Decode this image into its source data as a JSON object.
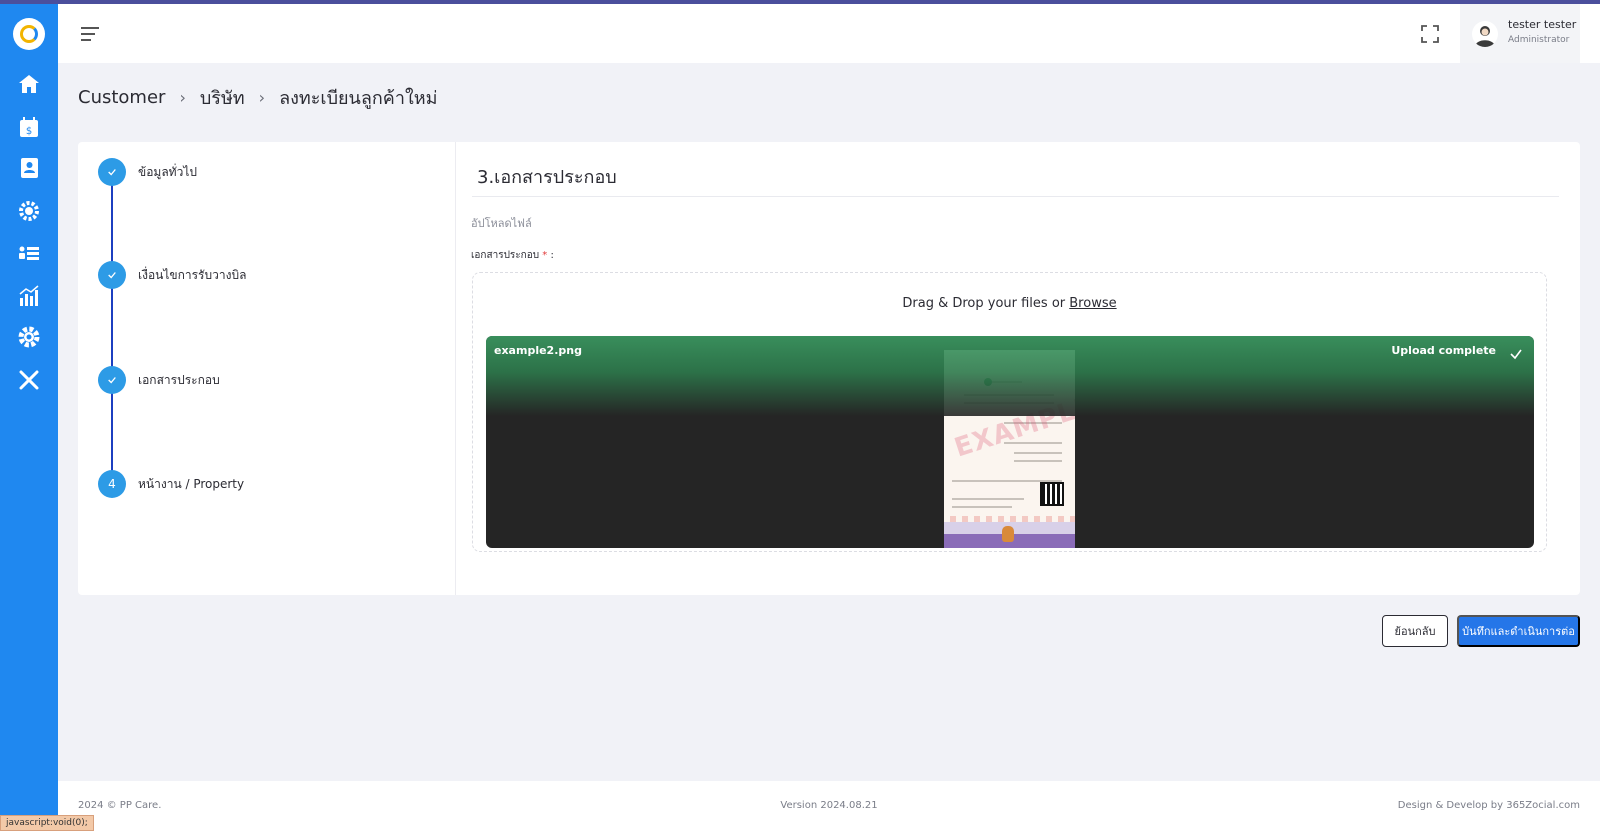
{
  "header": {
    "user_name": "tester tester",
    "user_role": "Administrator"
  },
  "sidebar": {
    "items": [
      {
        "icon": "home-icon"
      },
      {
        "icon": "billing-calendar-icon"
      },
      {
        "icon": "contact-book-icon"
      },
      {
        "icon": "users-gear-icon"
      },
      {
        "icon": "list-icon"
      },
      {
        "icon": "chart-icon"
      },
      {
        "icon": "gear-icon"
      },
      {
        "icon": "tools-icon"
      }
    ]
  },
  "breadcrumb": [
    "Customer",
    "บริษัท",
    "ลงทะเบียนลูกค้าใหม่"
  ],
  "steps": [
    {
      "marker": "",
      "label": "ข้อมูลทั่วไป",
      "done": true
    },
    {
      "marker": "",
      "label": "เงื่อนไขการรับวางบิล",
      "done": true
    },
    {
      "marker": "",
      "label": "เอกสารประกอบ",
      "done": true
    },
    {
      "marker": "4",
      "label": "หน้างาน / Property",
      "done": false
    }
  ],
  "section": {
    "title": "3.เอกสารประกอบ",
    "subhead": "อัปโหลดไฟล์",
    "field_label": "เอกสารประกอบ",
    "required_mark": "*",
    "field_suffix": ":"
  },
  "upload": {
    "drop_text": "Drag & Drop your files or",
    "browse_text": "Browse",
    "file_name": "example2.png",
    "status": "Upload complete"
  },
  "actions": {
    "back_label": "ย้อนกลับ",
    "save_label": "บันทึกและดำเนินการต่อ"
  },
  "footer": {
    "left": "2024 © PP Care.",
    "center": "Version 2024.08.21",
    "right": "Design & Develop by 365Zocial.com"
  },
  "status_bar": "javascript:void(0);",
  "colors": {
    "sidebar": "#1f88f0",
    "step_active": "#2d9be6",
    "step_line": "#1c3fc0",
    "primary_button": "#2576e8",
    "upload_complete": "#3b9a62"
  }
}
